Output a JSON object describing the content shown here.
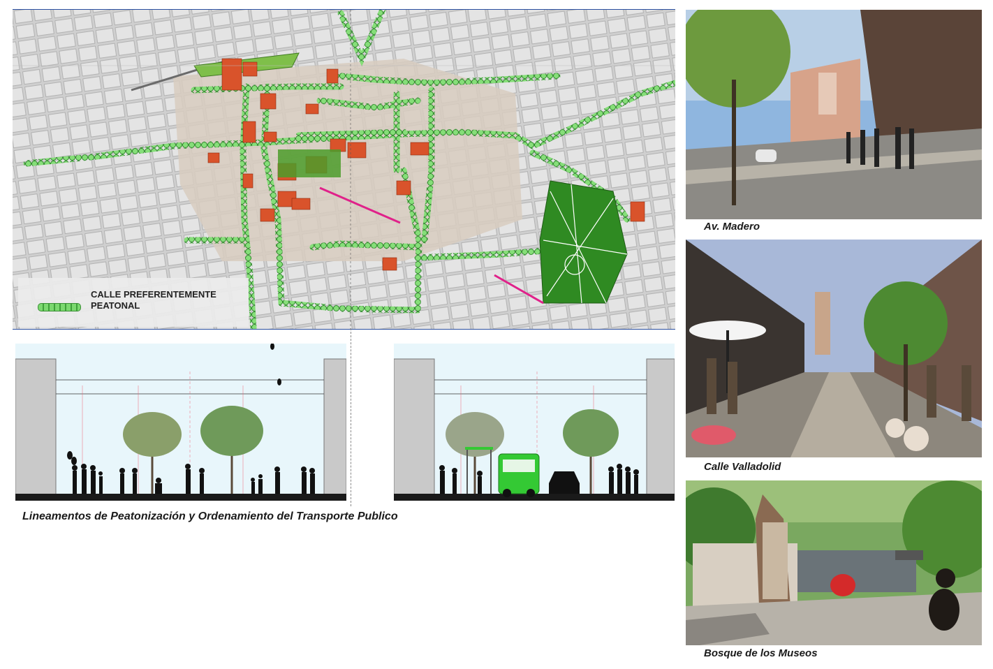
{
  "map": {
    "legend_label": "CALLE PREFERENTEMENTE PEATONAL"
  },
  "sections": {
    "caption": "Lineamentos de Peatonización y Ordenamiento del Transporte Publico"
  },
  "photos": [
    {
      "caption": "Av. Madero"
    },
    {
      "caption": "Calle Valladolid"
    },
    {
      "caption": "Bosque de los Museos"
    }
  ],
  "colors": {
    "pedestrian_street": "#7bd86f",
    "park": "#2f8a22",
    "heritage_building": "#d9532b",
    "axis_line": "#e0218a",
    "bus": "#34c934"
  }
}
